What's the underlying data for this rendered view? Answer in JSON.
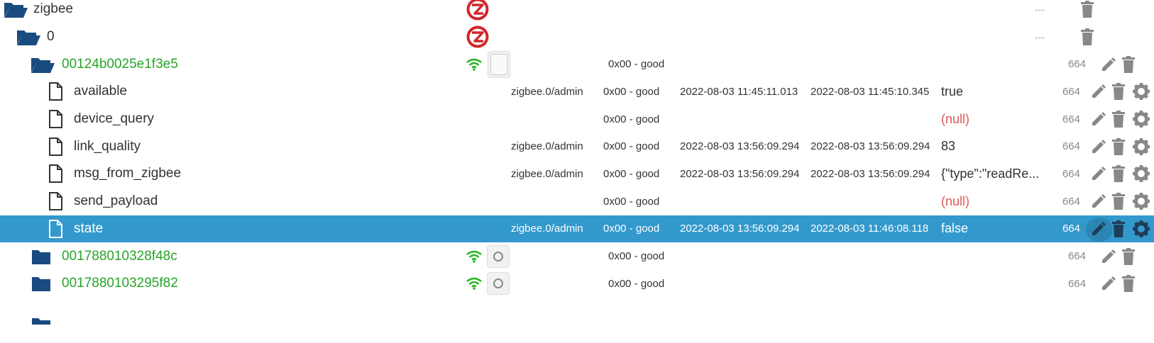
{
  "colors": {
    "folder": "#1a4b80",
    "device_name": "#28a428",
    "null_value": "#e05a5a",
    "selected_row": "#3399cc",
    "action_icon": "#888888",
    "wifi": "#2fb52f",
    "zigbee_logo": "#d0262a"
  },
  "rows": [
    {
      "name": "zigbee",
      "type": "folder-open",
      "badge": "zigbee-logo",
      "right": "---"
    },
    {
      "name": "0",
      "type": "folder-open",
      "badge": "zigbee-logo",
      "right": "---"
    },
    {
      "name": "00124b0025e1f3e5",
      "type": "folder-open",
      "signal": "wifi-icon",
      "status": "0x00 - good",
      "right": "664"
    },
    {
      "name": "available",
      "type": "file",
      "user": "zigbee.0/admin",
      "status": "0x00 - good",
      "ts": "2022-08-03 11:45:11.013",
      "lc": "2022-08-03 11:45:10.345",
      "value": "true",
      "right": "664"
    },
    {
      "name": "device_query",
      "type": "file",
      "status": "0x00 - good",
      "value": "(null)",
      "right": "664"
    },
    {
      "name": "link_quality",
      "type": "file",
      "user": "zigbee.0/admin",
      "status": "0x00 - good",
      "ts": "2022-08-03 13:56:09.294",
      "lc": "2022-08-03 13:56:09.294",
      "value": "83",
      "right": "664"
    },
    {
      "name": "msg_from_zigbee",
      "type": "file",
      "user": "zigbee.0/admin",
      "status": "0x00 - good",
      "ts": "2022-08-03 13:56:09.294",
      "lc": "2022-08-03 13:56:09.294",
      "value": "{\"type\":\"readRe...",
      "right": "664"
    },
    {
      "name": "send_payload",
      "type": "file",
      "status": "0x00 - good",
      "value": "(null)",
      "right": "664"
    },
    {
      "name": "state",
      "type": "file",
      "user": "zigbee.0/admin",
      "status": "0x00 - good",
      "ts": "2022-08-03 13:56:09.294",
      "lc": "2022-08-03 11:46:08.118",
      "value": "false",
      "right": "664",
      "selected": true
    },
    {
      "name": "001788010328f48c",
      "type": "folder-closed",
      "signal": "wifi-icon",
      "status": "0x00 - good",
      "right": "664"
    },
    {
      "name": "0017880103295f82",
      "type": "folder-closed",
      "signal": "wifi-icon",
      "status": "0x00 - good",
      "right": "664"
    }
  ]
}
